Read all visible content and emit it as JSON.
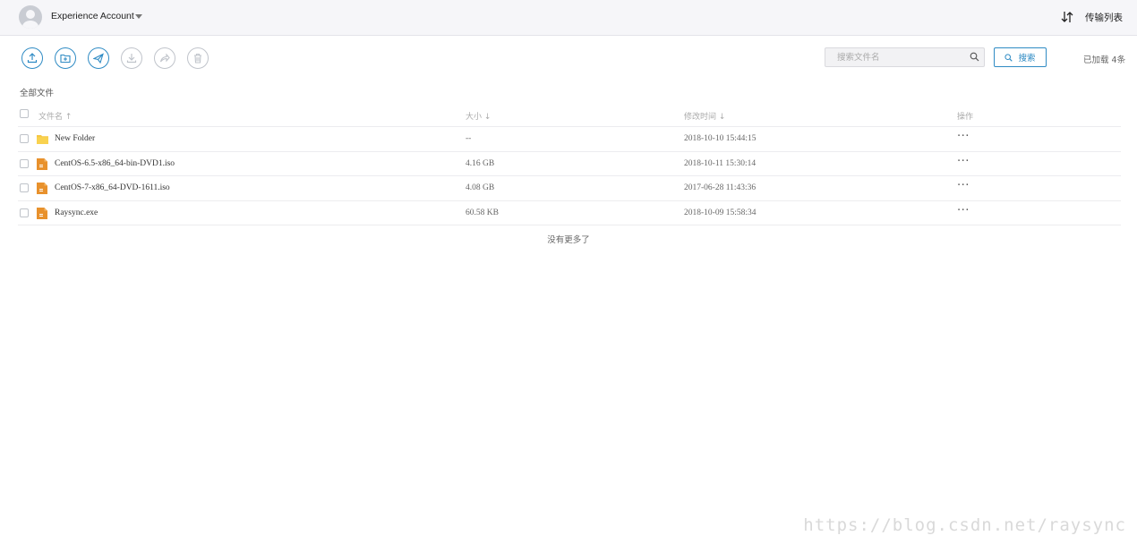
{
  "header": {
    "account_name": "Experience Account",
    "transfer_list_label": "传输列表"
  },
  "toolbar": {
    "buttons": [
      {
        "name": "upload",
        "state": "enabled"
      },
      {
        "name": "new-folder",
        "state": "enabled"
      },
      {
        "name": "send",
        "state": "enabled"
      },
      {
        "name": "download",
        "state": "disabled"
      },
      {
        "name": "share",
        "state": "disabled"
      },
      {
        "name": "delete",
        "state": "disabled"
      }
    ],
    "accent_color": "#2f8bc4",
    "disabled_color": "#c0c4cb"
  },
  "search": {
    "placeholder": "搜索文件名",
    "value": "",
    "button_label": "搜索"
  },
  "loaded_count": "已加载 4条",
  "breadcrumb": "全部文件",
  "table": {
    "columns": {
      "name": "文件名",
      "size": "大小",
      "modified": "修改时间",
      "actions": "操作"
    },
    "rows": [
      {
        "name": "New Folder",
        "type": "folder",
        "size": "--",
        "modified": "2018-10-10 15:44:15",
        "actions": "···"
      },
      {
        "name": "CentOS-6.5-x86_64-bin-DVD1.iso",
        "type": "file",
        "size": "4.16 GB",
        "modified": "2018-10-11 15:30:14",
        "actions": "···"
      },
      {
        "name": "CentOS-7-x86_64-DVD-1611.iso",
        "type": "file",
        "size": "4.08 GB",
        "modified": "2017-06-28 11:43:36",
        "actions": "···"
      },
      {
        "name": "Raysync.exe",
        "type": "file",
        "size": "60.58 KB",
        "modified": "2018-10-09 15:58:34",
        "actions": "···"
      }
    ]
  },
  "footer_note": "没有更多了",
  "watermark": "https://blog.csdn.net/raysync"
}
